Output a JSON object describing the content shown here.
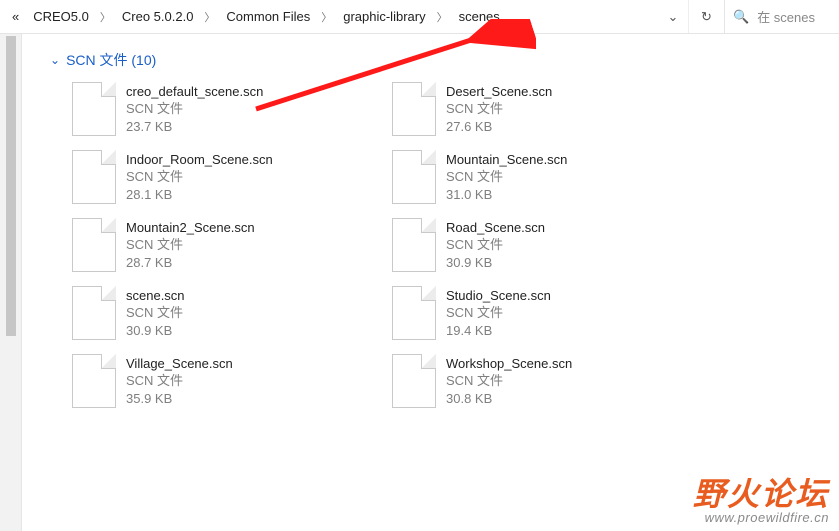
{
  "breadcrumb": {
    "overflow": "«",
    "items": [
      "CREO5.0",
      "Creo 5.0.2.0",
      "Common Files",
      "graphic-library",
      "scenes"
    ]
  },
  "search": {
    "placeholder": "在 scenes"
  },
  "group": {
    "label": "SCN 文件 (10)"
  },
  "files": [
    {
      "name": "creo_default_scene.scn",
      "type": "SCN 文件",
      "size": "23.7 KB"
    },
    {
      "name": "Desert_Scene.scn",
      "type": "SCN 文件",
      "size": "27.6 KB"
    },
    {
      "name": "Indoor_Room_Scene.scn",
      "type": "SCN 文件",
      "size": "28.1 KB"
    },
    {
      "name": "Mountain_Scene.scn",
      "type": "SCN 文件",
      "size": "31.0 KB"
    },
    {
      "name": "Mountain2_Scene.scn",
      "type": "SCN 文件",
      "size": "28.7 KB"
    },
    {
      "name": "Road_Scene.scn",
      "type": "SCN 文件",
      "size": "30.9 KB"
    },
    {
      "name": "scene.scn",
      "type": "SCN 文件",
      "size": "30.9 KB"
    },
    {
      "name": "Studio_Scene.scn",
      "type": "SCN 文件",
      "size": "19.4 KB"
    },
    {
      "name": "Village_Scene.scn",
      "type": "SCN 文件",
      "size": "35.9 KB"
    },
    {
      "name": "Workshop_Scene.scn",
      "type": "SCN 文件",
      "size": "30.8 KB"
    }
  ],
  "watermark": {
    "cn": "野火论坛",
    "url": "www.proewildfire.cn"
  }
}
